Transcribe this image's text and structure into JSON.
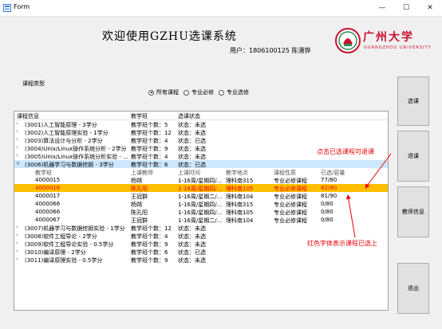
{
  "window": {
    "title": "Form",
    "minimize": "—",
    "maximize": "☐",
    "close": "✕"
  },
  "banner": {
    "welcome": "欢迎使用GZHU选课系统",
    "user_line": "用户：1806100125   陈湧铧",
    "school_name": "广州大学",
    "school_sub": "GUANGZHOU UNIVERSITY"
  },
  "filter": {
    "group_title": "课程类型",
    "options": [
      "所有课程",
      "专业必修",
      "专业选修"
    ],
    "selected": "所有课程"
  },
  "tree": {
    "headers": [
      "课程信息",
      "教学班",
      "选课状态"
    ],
    "sub_headers": [
      "教学班",
      "上课教师",
      "上课时间",
      "教学地点",
      "课程性质",
      "已选/容量"
    ],
    "courses_before": [
      [
        "(3001)人工智能原理 - 3学分",
        "教学班个数：5",
        "状态：未选"
      ],
      [
        "(3002)人工智能原理实验 - 1学分",
        "教学班个数：12",
        "状态：未选"
      ],
      [
        "(3003)算法设计与分析 - 2学分",
        "教学班个数：4",
        "状态：已选"
      ],
      [
        "(3004)Unix/Linux操作系统分析 - 2学分",
        "教学班个数：9",
        "状态：未选"
      ],
      [
        "(3005)Unix/Linux操作系统分析实验 - ...",
        "教学班个数：4",
        "状态：未选"
      ]
    ],
    "expanded": [
      "(3006)机器学习与数据挖掘 - 3学分",
      "教学班个数：6",
      "状态：已选"
    ],
    "classes": [
      [
        "4000015",
        "杨朔",
        "1-16周/星期四/...",
        "理科南315",
        "专业必修课程",
        "77/80"
      ],
      [
        "4000016",
        "陈孔阳",
        "1-16周/星期四/...",
        "理科南105",
        "专业必修课程",
        "82/90"
      ],
      [
        "4000017",
        "王冠群",
        "1-16周/星期二/...",
        "理科南104",
        "专业必修课程",
        "81/90"
      ],
      [
        "4000066",
        "杨朔",
        "1-16周/星期四/...",
        "理科南315",
        "专业必修课程",
        "0/80"
      ],
      [
        "4000066",
        "陈孔阳",
        "1-16周/星期四/...",
        "理科南105",
        "专业必修课程",
        "0/80"
      ],
      [
        "4000067",
        "王冠群",
        "1-16周/星期二/...",
        "理科南104",
        "专业必修课程",
        "0/80"
      ]
    ],
    "highlight_index": 1,
    "courses_after": [
      [
        "(3007)机器学习与数据挖掘实验 - 1学分",
        "教学班个数：12",
        "状态：未选"
      ],
      [
        "(3008)软件工程导论 - 2学分",
        "教学班个数：4",
        "状态：未选"
      ],
      [
        "(3009)软件工程导论实验 - 0.5学分",
        "教学班个数：9",
        "状态：未选"
      ],
      [
        "(3010)编译原理 - 2学分",
        "教学班个数：6",
        "状态：已选"
      ],
      [
        "(3011)编译原理实验 - 0.5学分",
        "教学班个数：9",
        "状态：未选"
      ]
    ]
  },
  "buttons": {
    "select": "选课",
    "drop": "退课",
    "teacher": "教师信息",
    "exit": "退出"
  },
  "annotations": {
    "top": "点击已选课程可退课",
    "bottom": "红色字体表示课程已选上"
  },
  "colors": {
    "highlight": "#ffbf00",
    "selected_row": "#cde8ff",
    "annotation": "#e00000"
  }
}
